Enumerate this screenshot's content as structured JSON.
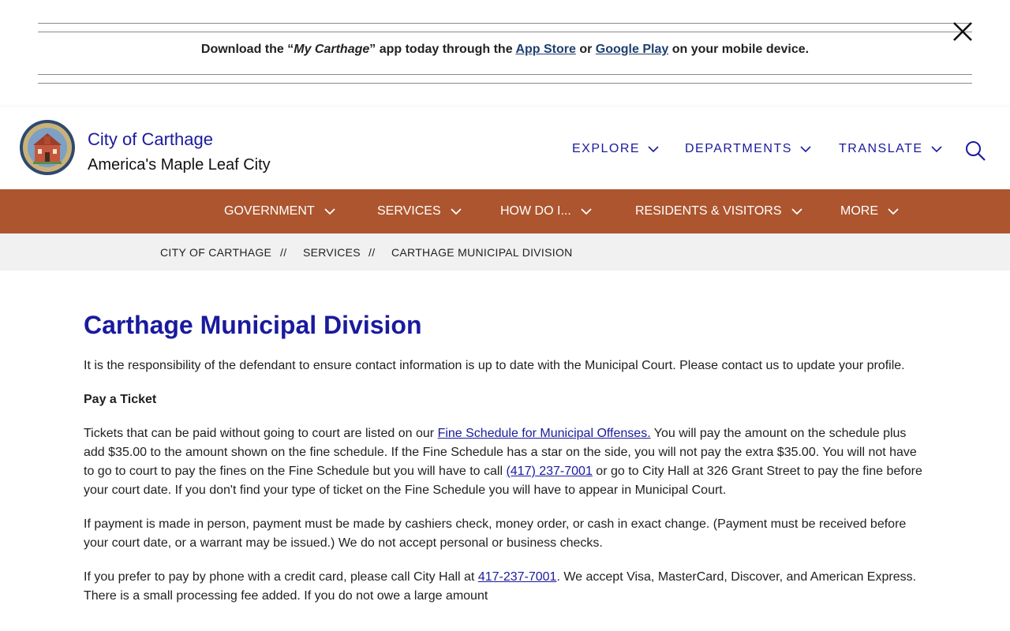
{
  "banner": {
    "prefix": "Download the “",
    "app_name": "My Carthage",
    "middle": "” app today through the ",
    "app_store": "App Store",
    "or": " or ",
    "google_play": "Google Play",
    "suffix": " on your mobile device.",
    "close_icon": "close-icon"
  },
  "header": {
    "site_name": "City of Carthage",
    "tagline": "America's Maple Leaf City",
    "util_nav": [
      "EXPLORE",
      "DEPARTMENTS",
      "TRANSLATE"
    ],
    "search_icon": "search-icon"
  },
  "main_nav": [
    "GOVERNMENT",
    "SERVICES",
    "HOW DO I...",
    "RESIDENTS & VISITORS",
    "MORE"
  ],
  "breadcrumb": {
    "items": [
      "CITY OF CARTHAGE",
      "SERVICES",
      "CARTHAGE MUNICIPAL DIVISION"
    ],
    "separator": "//"
  },
  "page": {
    "title": "Carthage Municipal Division",
    "intro": "It is the responsibility of the defendant to ensure contact information is up to date with the Municipal Court. Please contact us to update your profile.",
    "pay_heading": "Pay a Ticket",
    "p2_a": "Tickets that can be paid without going to court are listed on our ",
    "p2_link": "Fine Schedule for Municipal Offenses.",
    "p2_b": " You will pay the amount on the schedule plus add $35.00 to the amount shown on the fine schedule. If the Fine Schedule has a star on the side, you will not pay the extra $35.00. You will not have to go to court to pay the fines on the Fine Schedule but you will have to call ",
    "p2_phone": "(417) 237-7001",
    "p2_c": " or go to City Hall at 326 Grant Street to pay the fine before your court date. If you don't find your type of ticket on the Fine Schedule you will have to appear in Municipal Court.",
    "p3": "If payment is made in person, payment must be made by cashiers check, money order, or cash in exact change. (Payment must be received before your court date, or a warrant may be issued.) We do not accept personal or business checks.",
    "p4_a": "If you prefer to pay by phone with a credit card, please call City Hall at ",
    "p4_phone": "417-237-7001",
    "p4_b": ". We accept Visa, MasterCard, Discover, and American Express. There is a small processing fee added. If you do not owe a large amount"
  },
  "colors": {
    "accent": "#ad552f",
    "link": "#1a1a9e",
    "breadcrumb_bg": "#f1f1f1"
  }
}
